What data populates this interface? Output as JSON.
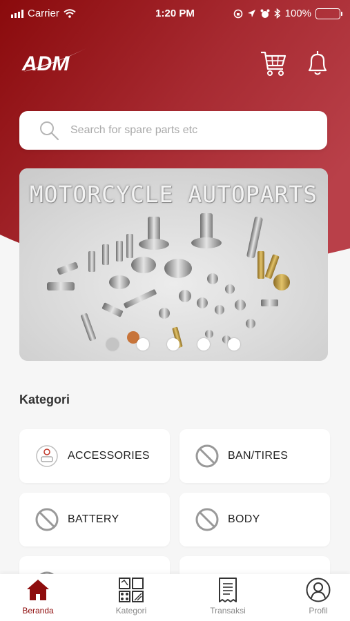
{
  "status_bar": {
    "carrier": "Carrier",
    "time": "1:20 PM",
    "battery": "100%"
  },
  "header": {
    "logo_text": "ADM",
    "cart_icon": "cart-icon",
    "bell_icon": "bell-icon"
  },
  "search": {
    "placeholder": "Search for spare parts etc"
  },
  "banner": {
    "title": "MOTORCYCLE AUTOPARTS",
    "slide_count": 5,
    "active_slide": 1
  },
  "categories": {
    "title": "Kategori",
    "items": [
      {
        "label": "ACCESSORIES",
        "icon": "accessories-icon"
      },
      {
        "label": "BAN/TIRES",
        "icon": "no-image-icon"
      },
      {
        "label": "BATTERY",
        "icon": "no-image-icon"
      },
      {
        "label": "BODY",
        "icon": "no-image-icon"
      }
    ]
  },
  "tabbar": {
    "items": [
      {
        "label": "Beranda",
        "icon": "home-icon",
        "active": true
      },
      {
        "label": "Kategori",
        "icon": "grid-icon",
        "active": false
      },
      {
        "label": "Transaksi",
        "icon": "receipt-icon",
        "active": false
      },
      {
        "label": "Profil",
        "icon": "profile-icon",
        "active": false
      }
    ]
  },
  "colors": {
    "brand": "#8e0d0d",
    "brand_light": "#b2343a",
    "background": "#f6f6f6",
    "card": "#ffffff"
  }
}
